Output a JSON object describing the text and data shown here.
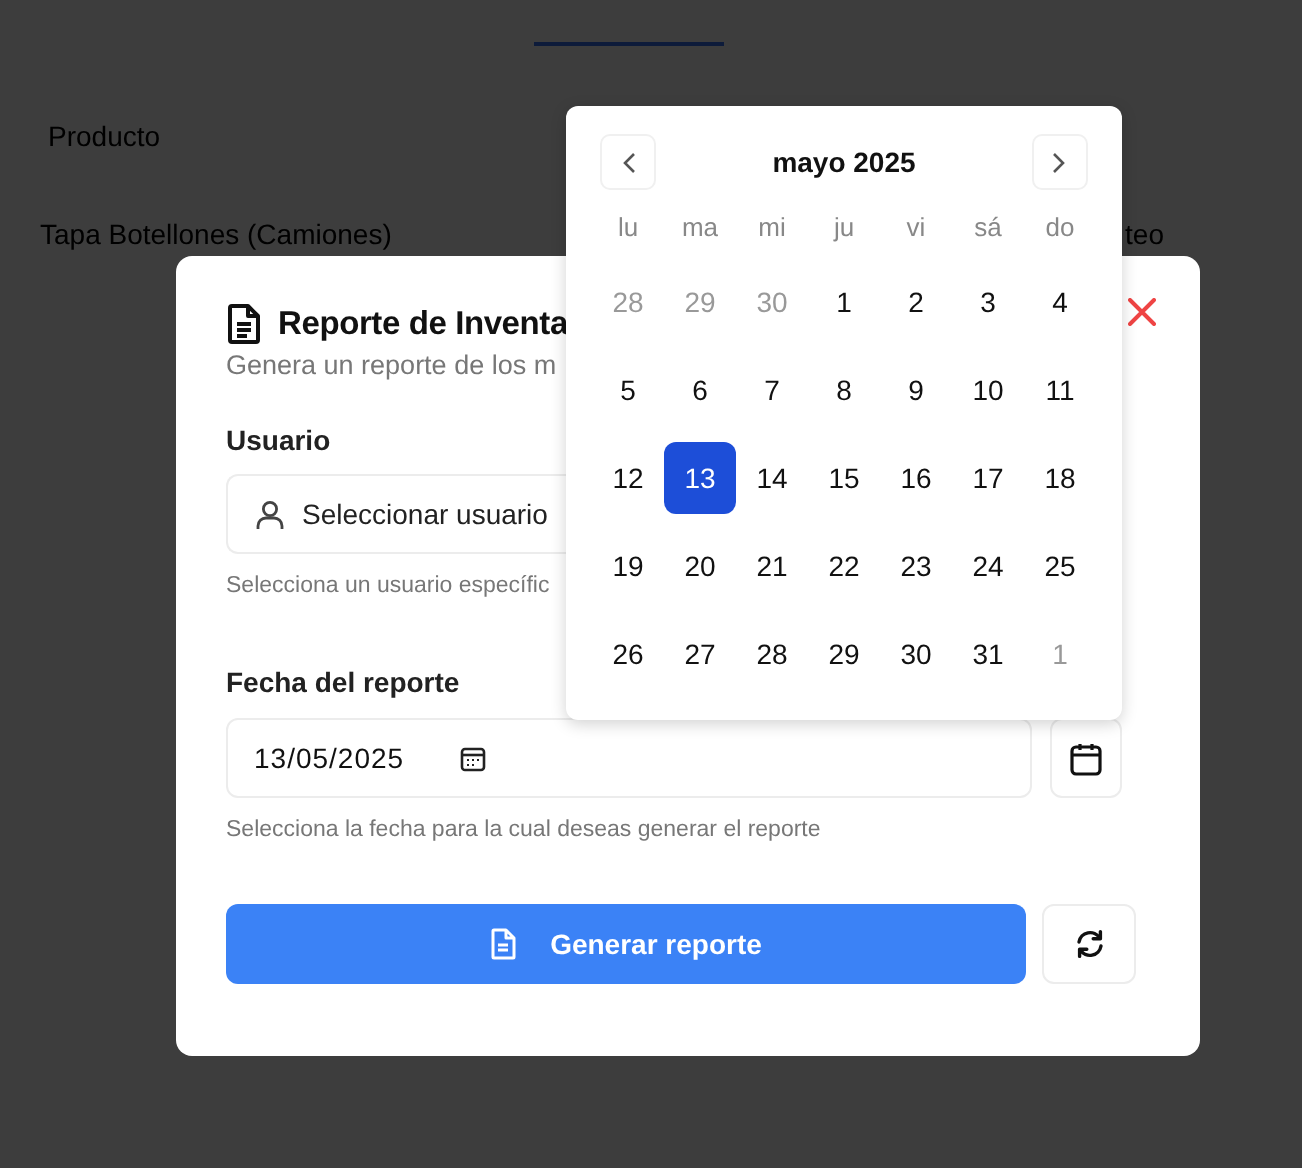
{
  "table": {
    "columns": [
      "Producto"
    ],
    "rows": [
      [
        "Tapa Botellones (Camiones)",
        "teo"
      ]
    ]
  },
  "dialog": {
    "title": "Reporte de Inventa",
    "subtitle": "Genera un reporte de los m",
    "user_field": {
      "label": "Usuario",
      "placeholder": "Seleccionar usuario",
      "hint": "Selecciona un usuario específic"
    },
    "date_field": {
      "label": "Fecha del reporte",
      "value": "13/05/2025",
      "hint": "Selecciona la fecha para la cual deseas generar el reporte"
    },
    "generate_button": "Generar reporte"
  },
  "date_picker": {
    "month": "mayo 2025",
    "weekdays": [
      "lu",
      "ma",
      "mi",
      "ju",
      "vi",
      "sá",
      "do"
    ],
    "weeks": [
      [
        {
          "day": "28",
          "muted": true,
          "selected": false
        },
        {
          "day": "29",
          "muted": true,
          "selected": false
        },
        {
          "day": "30",
          "muted": true,
          "selected": false
        },
        {
          "day": "1",
          "muted": false,
          "selected": false
        },
        {
          "day": "2",
          "muted": false,
          "selected": false
        },
        {
          "day": "3",
          "muted": false,
          "selected": false
        },
        {
          "day": "4",
          "muted": false,
          "selected": false
        }
      ],
      [
        {
          "day": "5",
          "muted": false,
          "selected": false
        },
        {
          "day": "6",
          "muted": false,
          "selected": false
        },
        {
          "day": "7",
          "muted": false,
          "selected": false
        },
        {
          "day": "8",
          "muted": false,
          "selected": false
        },
        {
          "day": "9",
          "muted": false,
          "selected": false
        },
        {
          "day": "10",
          "muted": false,
          "selected": false
        },
        {
          "day": "11",
          "muted": false,
          "selected": false
        }
      ],
      [
        {
          "day": "12",
          "muted": false,
          "selected": false
        },
        {
          "day": "13",
          "muted": false,
          "selected": true
        },
        {
          "day": "14",
          "muted": false,
          "selected": false
        },
        {
          "day": "15",
          "muted": false,
          "selected": false
        },
        {
          "day": "16",
          "muted": false,
          "selected": false
        },
        {
          "day": "17",
          "muted": false,
          "selected": false
        },
        {
          "day": "18",
          "muted": false,
          "selected": false
        }
      ],
      [
        {
          "day": "19",
          "muted": false,
          "selected": false
        },
        {
          "day": "20",
          "muted": false,
          "selected": false
        },
        {
          "day": "21",
          "muted": false,
          "selected": false
        },
        {
          "day": "22",
          "muted": false,
          "selected": false
        },
        {
          "day": "23",
          "muted": false,
          "selected": false
        },
        {
          "day": "24",
          "muted": false,
          "selected": false
        },
        {
          "day": "25",
          "muted": false,
          "selected": false
        }
      ],
      [
        {
          "day": "26",
          "muted": false,
          "selected": false
        },
        {
          "day": "27",
          "muted": false,
          "selected": false
        },
        {
          "day": "28",
          "muted": false,
          "selected": false
        },
        {
          "day": "29",
          "muted": false,
          "selected": false
        },
        {
          "day": "30",
          "muted": false,
          "selected": false
        },
        {
          "day": "31",
          "muted": false,
          "selected": false
        },
        {
          "day": "1",
          "muted": true,
          "selected": false
        }
      ]
    ]
  }
}
